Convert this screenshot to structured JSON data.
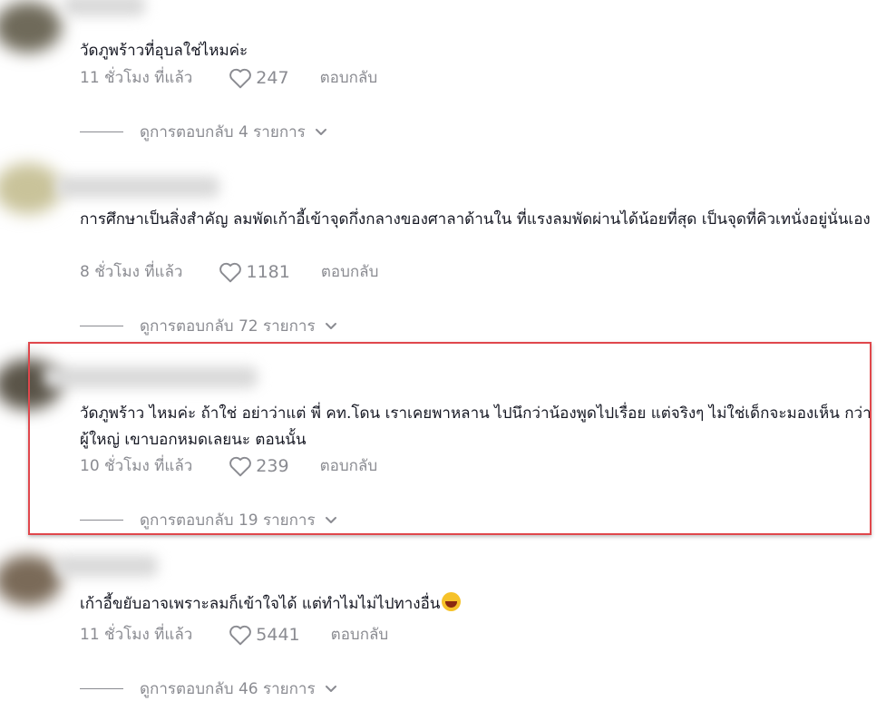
{
  "comments": [
    {
      "text": "วัดภูพร้าวที่อุบลใช่ไหมค่ะ",
      "time": "11 ชั่วโมง ที่แล้ว",
      "likes": "247",
      "reply": "ตอบกลับ",
      "view_replies": "ดูการตอบกลับ 4 รายการ"
    },
    {
      "text": "การศึกษาเป็นสิ่งสำคัญ ลมพัดเก้าอี้เข้าจุดกึ่งกลางของศาลาด้านใน ที่แรงลมพัดผ่านได้น้อยที่สุด เป็นจุดที่คิวเทนั่งอยู่นั่นเอง",
      "time": "8 ชั่วโมง ที่แล้ว",
      "likes": "1181",
      "reply": "ตอบกลับ",
      "view_replies": "ดูการตอบกลับ 72 รายการ"
    },
    {
      "text": "วัดภูพร้าว ไหมค่ะ ถ้าใช่ อย่าว่าแต่ พี่ คท.โดน เราเคยพาหลาน ไปนึกว่าน้องพูดไปเรื่อย แต่จริงๆ ไม่ใช่เด็กจะมองเห็น กว่าผู้ใหญ่ เขาบอกหมดเลยนะ ตอนนั้น",
      "time": "10 ชั่วโมง ที่แล้ว",
      "likes": "239",
      "reply": "ตอบกลับ",
      "view_replies": "ดูการตอบกลับ 19 รายการ"
    },
    {
      "text": "เก้าอี้ขยับอาจเพราะลมก็เข้าใจได้ แต่ทำไมไม่ไปทางอื่น",
      "emoji": "laughing-face-emoji",
      "time": "11 ชั่วโมง ที่แล้ว",
      "likes": "5441",
      "reply": "ตอบกลับ",
      "view_replies": "ดูการตอบกลับ 46 รายการ"
    }
  ],
  "colors": {
    "text": "#161823",
    "muted": "#8a8b91",
    "highlight_border": "#e0474c"
  }
}
